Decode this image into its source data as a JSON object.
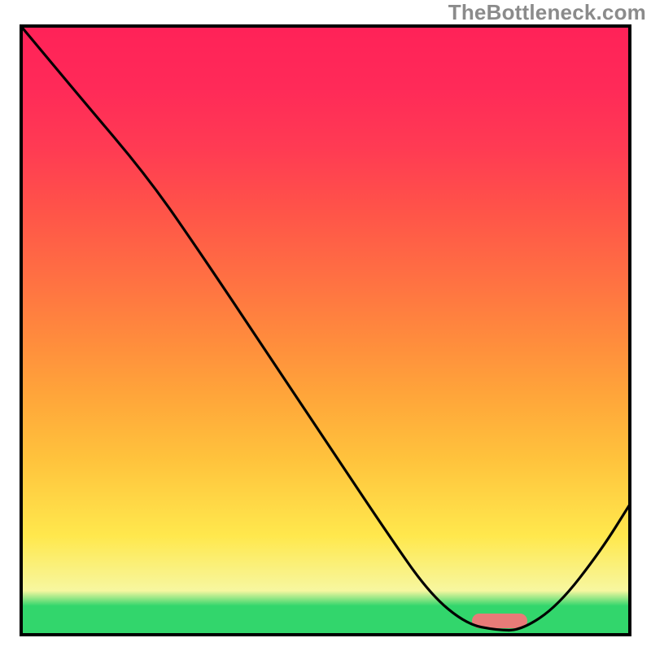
{
  "watermark": "TheBottleneck.com",
  "colors": {
    "curve_stroke": "#000000",
    "marker_fill": "#e87b78",
    "frame_stroke": "#000000"
  },
  "chart_data": {
    "type": "line",
    "title": "",
    "xlabel": "",
    "ylabel": "",
    "xlim": [
      0,
      100
    ],
    "ylim": [
      0,
      100
    ],
    "grid": false,
    "legend": false,
    "series": [
      {
        "name": "bottleneck-curve",
        "x": [
          0,
          10,
          21,
          30,
          40,
          50,
          60,
          67,
          73,
          78,
          82,
          88,
          95,
          100
        ],
        "values": [
          100,
          88,
          75,
          62,
          47,
          32,
          17,
          7,
          2,
          1,
          1,
          5,
          14,
          22
        ]
      }
    ],
    "marker": {
      "x_start": 74,
      "x_end": 83,
      "y": 2.5
    },
    "note": "Axes have no tick labels in the source image; values are read as 0–100 relative."
  }
}
